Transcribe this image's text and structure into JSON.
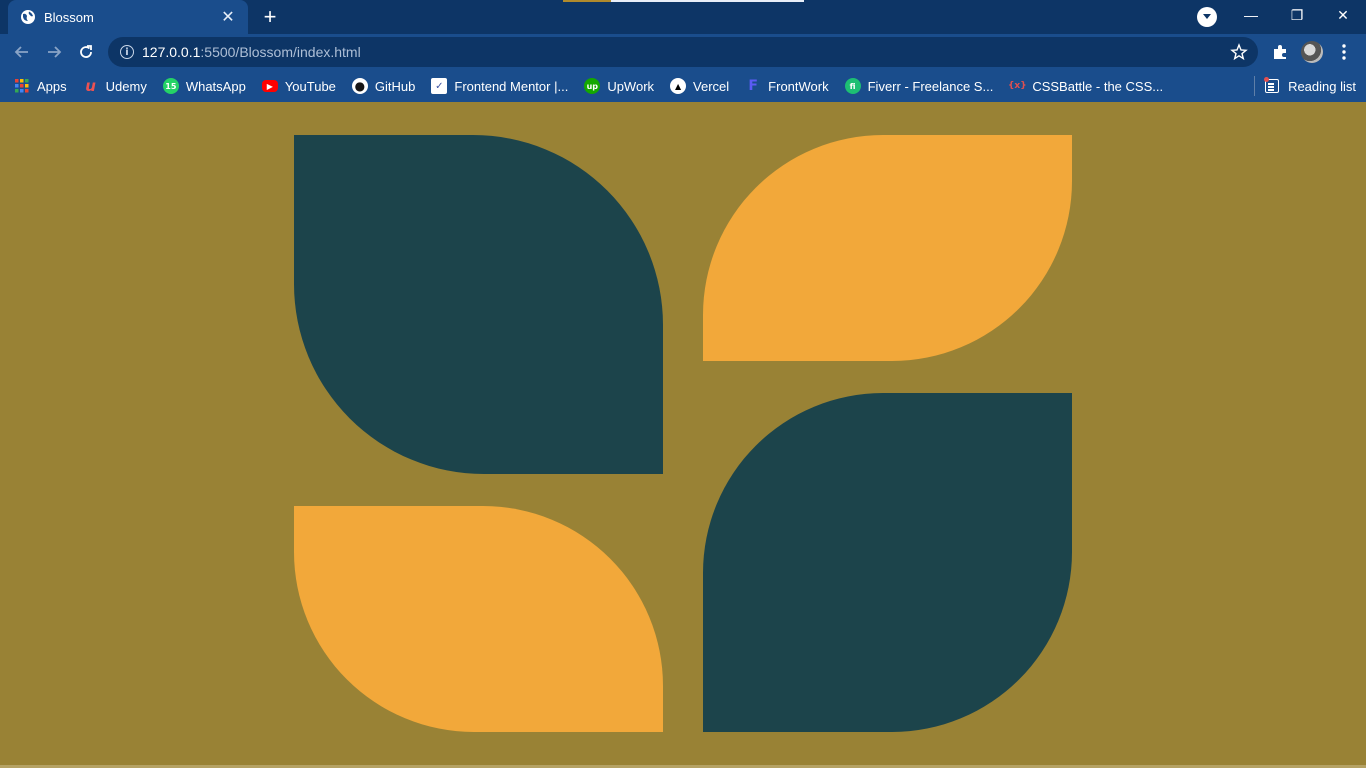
{
  "browser": {
    "tab": {
      "title": "Blossom",
      "close": "✕",
      "icon": "globe-icon"
    },
    "new_tab": "+",
    "window_controls": {
      "minimize": "—",
      "restore": "❐",
      "close": "✕"
    },
    "url": {
      "host": "127.0.0.1",
      "rest": ":5500/Blossom/index.html"
    },
    "omnibox_info": "i"
  },
  "bookmarks": [
    {
      "label": "Apps",
      "icon": "apps-grid-icon",
      "color": "#ea4335"
    },
    {
      "label": "Udemy",
      "icon": "udemy-icon",
      "color": "#ec5252",
      "glyph": "u"
    },
    {
      "label": "WhatsApp",
      "icon": "whatsapp-icon",
      "color": "#25d366",
      "glyph": "15"
    },
    {
      "label": "YouTube",
      "icon": "youtube-icon",
      "color": "#ff0000",
      "glyph": "▶"
    },
    {
      "label": "GitHub",
      "icon": "github-icon",
      "color": "#171515",
      "glyph": "●"
    },
    {
      "label": "Frontend Mentor |...",
      "icon": "frontend-mentor-icon",
      "color": "#ffffff",
      "glyph": "✓"
    },
    {
      "label": "UpWork",
      "icon": "upwork-icon",
      "color": "#14a800",
      "glyph": "up"
    },
    {
      "label": "Vercel",
      "icon": "vercel-icon",
      "color": "#000000",
      "glyph": "▲"
    },
    {
      "label": "FrontWork",
      "icon": "frontwork-icon",
      "color": "#5b5bf5",
      "glyph": "F"
    },
    {
      "label": "Fiverr - Freelance S...",
      "icon": "fiverr-icon",
      "color": "#1dbf73",
      "glyph": "fi"
    },
    {
      "label": "CSSBattle - the CSS...",
      "icon": "cssbattle-icon",
      "color": "#e05050",
      "glyph": "{x}"
    }
  ],
  "reading_list": {
    "label": "Reading list",
    "icon": "reading-list-icon"
  },
  "colors": {
    "page_background": "#998235",
    "petal_dark": "#1c444b",
    "petal_orange": "#f2a83a",
    "tab_strip": "#0d3566",
    "toolbar": "#1a4d8c"
  },
  "petals": [
    {
      "name": "petal-top-left",
      "color": "#1c444b"
    },
    {
      "name": "petal-top-right",
      "color": "#f2a83a"
    },
    {
      "name": "petal-bottom-left",
      "color": "#f2a83a"
    },
    {
      "name": "petal-bottom-right",
      "color": "#1c444b"
    }
  ]
}
